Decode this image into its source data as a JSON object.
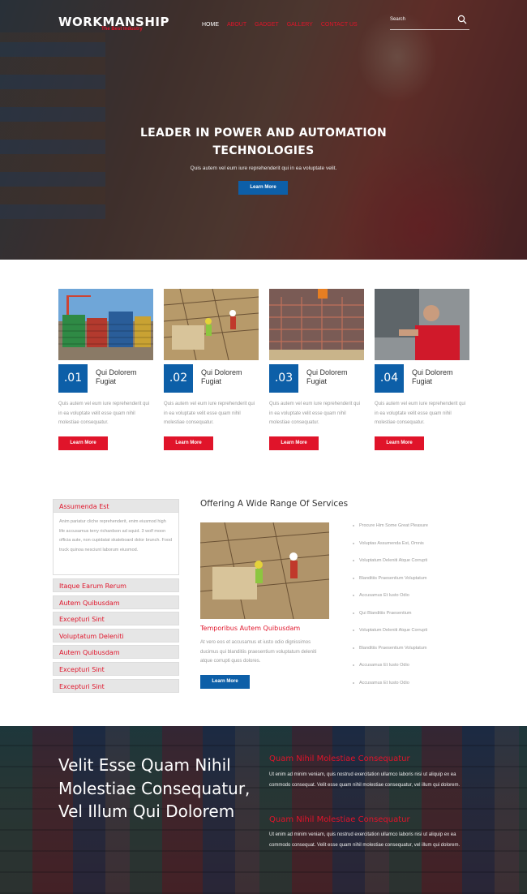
{
  "header": {
    "logo": "WORKMANSHIP",
    "tagline": "The Best Industry",
    "nav": [
      "HOME",
      "ABOUT",
      "GADGET",
      "GALLERY",
      "CONTACT US"
    ],
    "search_placeholder": "Search"
  },
  "hero": {
    "title_line1": "LEADER IN POWER AND AUTOMATION",
    "title_line2": "TECHNOLOGIES",
    "subtitle": "Quis autem vel eum iure reprehenderit qui in ea voluptate velit.",
    "button": "Learn More"
  },
  "cards": [
    {
      "num": ".01",
      "title1": "Qui Dolorem",
      "title2": "Fugiat",
      "desc": "Quis autem vel eum iure reprehenderit qui in ea voluptate velit esse quam nihil molestiae consequatur.",
      "button": "Learn More"
    },
    {
      "num": ".02",
      "title1": "Qui Dolorem",
      "title2": "Fugiat",
      "desc": "Quis autem vel eum iure reprehenderit qui in ea voluptate velit esse quam nihil molestiae consequatur.",
      "button": "Learn More"
    },
    {
      "num": ".03",
      "title1": "Qui Dolorem",
      "title2": "Fugiat",
      "desc": "Quis autem vel eum iure reprehenderit qui in ea voluptate velit esse quam nihil molestiae consequatur.",
      "button": "Learn More"
    },
    {
      "num": ".04",
      "title1": "Qui Dolorem",
      "title2": "Fugiat",
      "desc": "Quis autem vel eum iure reprehenderit qui in ea voluptate velit esse quam nihil molestiae consequatur.",
      "button": "Learn More"
    }
  ],
  "accordion": {
    "open": "Assumenda Est",
    "open_text": "Anim pariatur cliche reprehenderit, enim eiusmod high life accusamus terry richardson ad squid. 3 wolf moon officia aute, non cupidatat skateboard dolor brunch. Food truck quinoa nesciunt laborum eiusmod.",
    "items": [
      "Itaque Earum Rerum",
      "Autem Quibusdam",
      "Excepturi Sint",
      "Voluptatum Deleniti",
      "Autem Quibusdam",
      "Excepturi Sint",
      "Excepturi Sint"
    ]
  },
  "services": {
    "title": "Offering A Wide Range Of Services",
    "sub": "Temporibus Autem Quibusdam",
    "desc": "At vero eos et accusamus et iusto odio dignissimos ducimus qui blanditiis praesentium voluptatum deleniti atque corrupti quos dolores.",
    "button": "Learn More",
    "list": [
      "Procure Him Some Great Pleasure",
      "Voluptas Assumenda Est, Omnis",
      "Voluptatum Deleniti Atque Corrupti",
      "Blanditiis Praesentium Voluptatum",
      "Accusamus Et Iusto Odio",
      "Qui Blanditiis Praesentium",
      "Voluptatum Deleniti Atque Corrupti",
      "Blanditiis Praesentium Voluptatum",
      "Accusamus Et Iusto Odio",
      "Accusamus Et Iusto Odio"
    ]
  },
  "bottom": {
    "big_title": "Velit Esse Quam Nihil Molestiae Consequatur, Vel Illum Qui Dolorem",
    "h1": "Quam Nihil Molestiae Consequatur",
    "p1": "Ut enim ad minim veniam, quis nostrud exercitation ullamco laboris nisi ut aliquip ex ea commodo consequat. Velit esse quam nihil molestiae consequatur, vel illum qui dolorem.",
    "h2": "Quam Nihil Molestiae Consequatur",
    "p2": "Ut enim ad minim veniam, quis nostrud exercitation ullamco laboris nisi ut aliquip ex ea commodo consequat. Velit esse quam nihil molestiae consequatur, vel illum qui dolorem."
  },
  "colors": {
    "accent": "#e0142a",
    "brand_blue": "#0d5fa8"
  }
}
